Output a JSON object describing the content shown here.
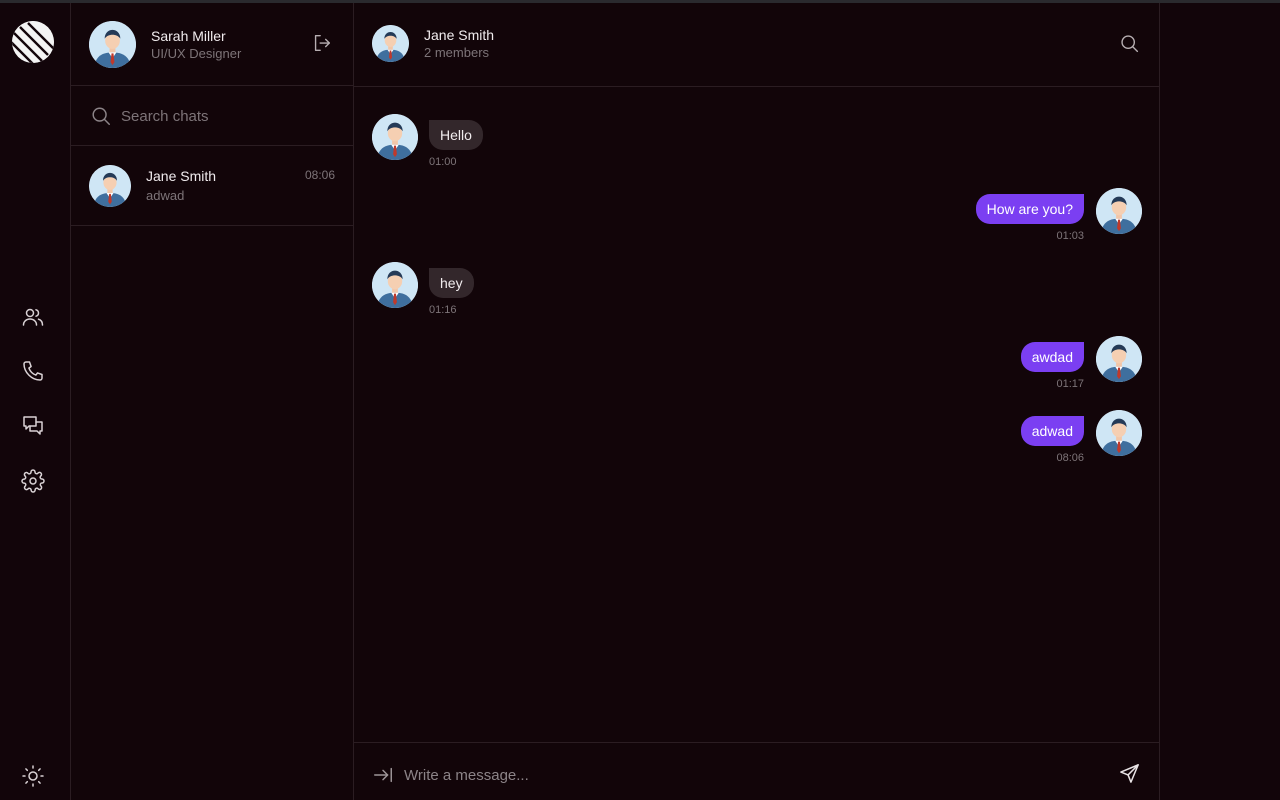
{
  "colors": {
    "background": "#120509",
    "outgoing_bubble": "#7b3ff2",
    "incoming_bubble": "#33272b",
    "muted_text": "#7d7478"
  },
  "rail": {
    "logo": "app-logo",
    "items": [
      {
        "icon": "users-icon"
      },
      {
        "icon": "phone-icon"
      },
      {
        "icon": "chats-icon"
      },
      {
        "icon": "gear-icon"
      }
    ],
    "theme_icon": "sun-icon"
  },
  "profile": {
    "name": "Sarah Miller",
    "role": "UI/UX Designer",
    "logout_icon": "logout-icon"
  },
  "search": {
    "placeholder": "Search chats"
  },
  "chats": [
    {
      "name": "Jane Smith",
      "last_message": "adwad",
      "time": "08:06"
    }
  ],
  "conversation": {
    "title": "Jane Smith",
    "subtitle": "2 members",
    "messages": [
      {
        "direction": "in",
        "text": "Hello",
        "time": "01:00"
      },
      {
        "direction": "out",
        "text": "How are you?",
        "time": "01:03"
      },
      {
        "direction": "in",
        "text": "hey",
        "time": "01:16"
      },
      {
        "direction": "out",
        "text": "awdad",
        "time": "01:17"
      },
      {
        "direction": "out",
        "text": "adwad",
        "time": "08:06"
      }
    ]
  },
  "composer": {
    "placeholder": "Write a message...",
    "attach_icon": "attach-icon",
    "send_icon": "send-icon"
  }
}
